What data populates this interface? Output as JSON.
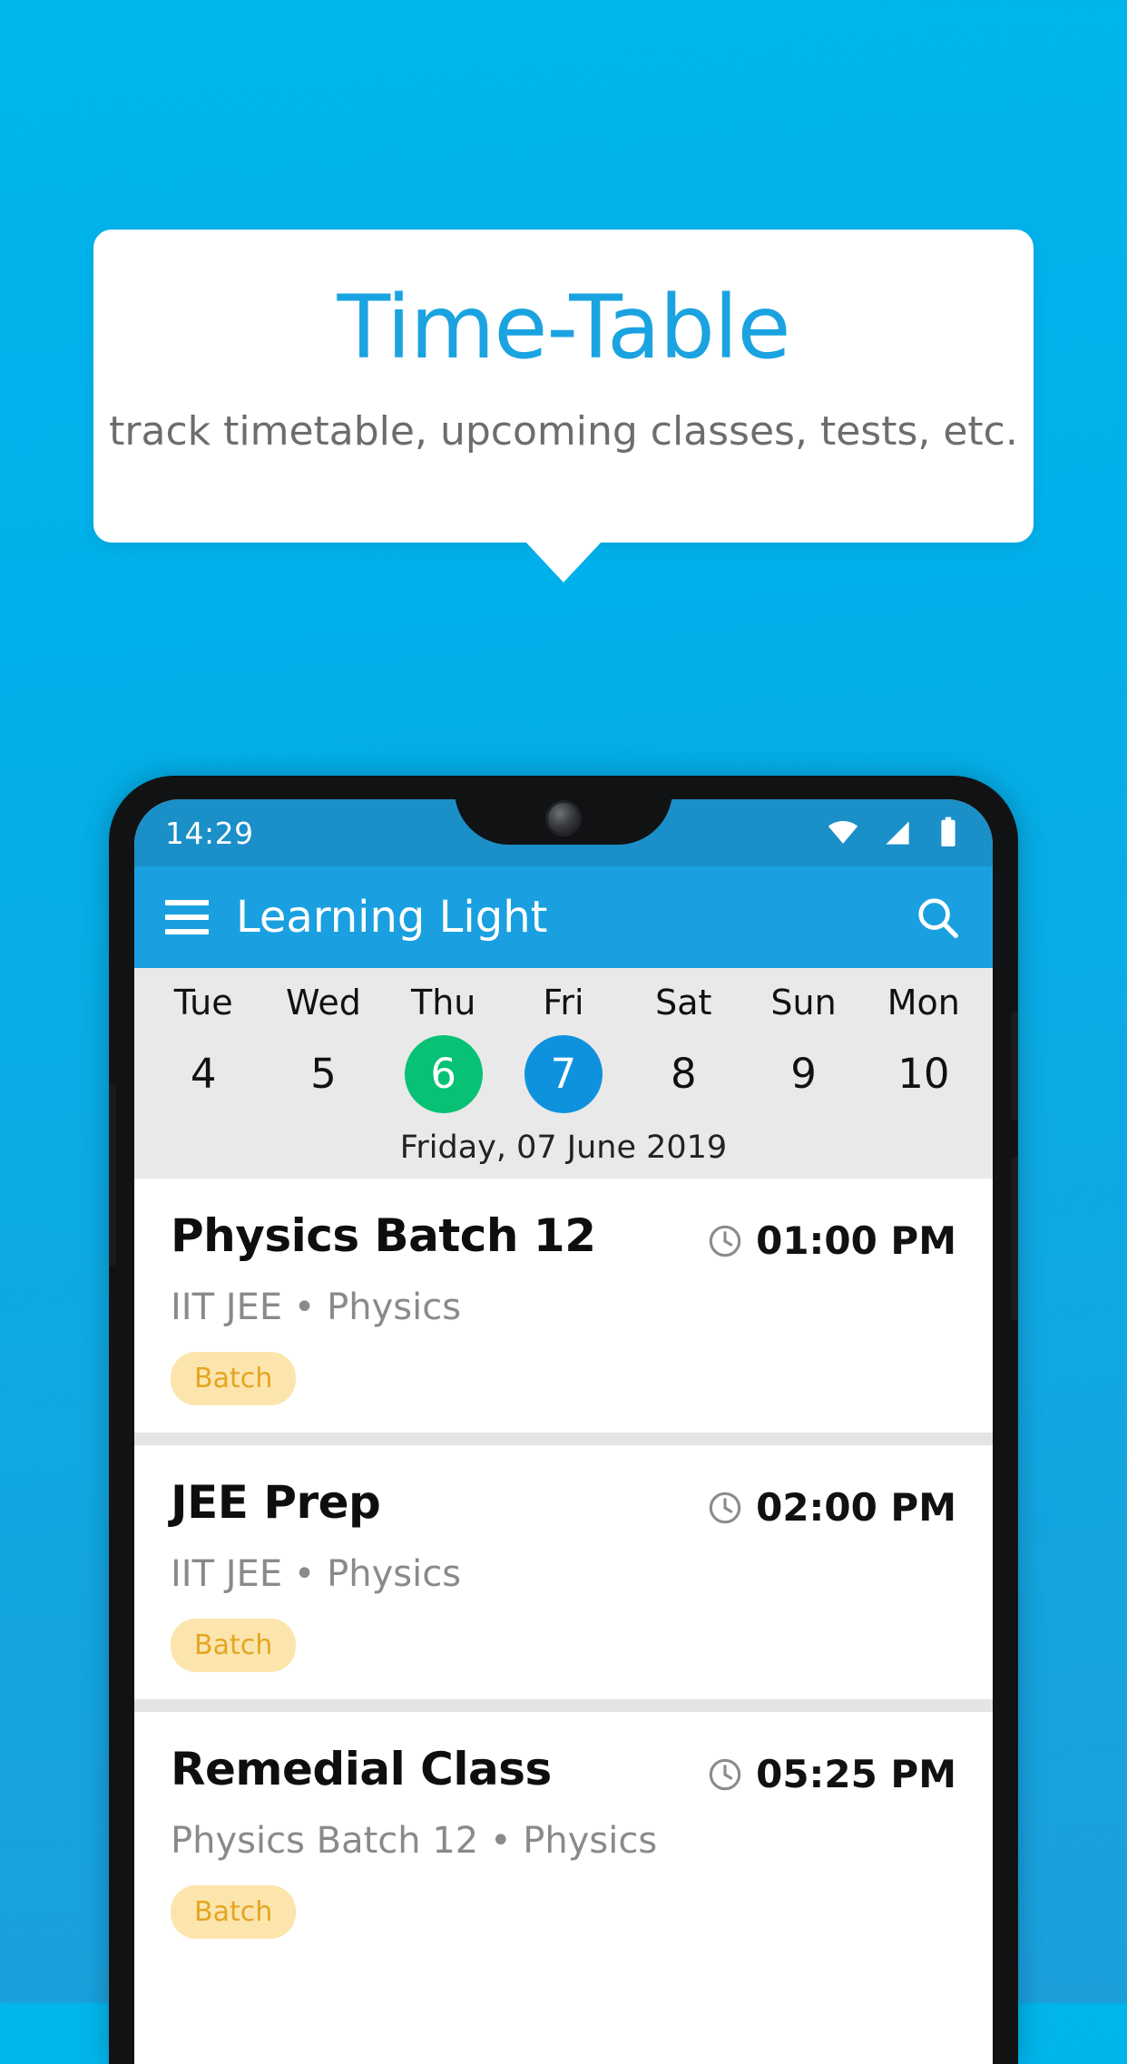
{
  "promo": {
    "title": "Time-Table",
    "subtitle": "track timetable, upcoming classes, tests, etc.",
    "title_color": "#1aa3e0",
    "background_color": "#00b0ea"
  },
  "status_bar": {
    "time": "14:29",
    "icons": [
      "wifi-icon",
      "signal-icon",
      "battery-icon"
    ]
  },
  "app_bar": {
    "menu_icon": "hamburger-menu-icon",
    "title": "Learning Light",
    "search_icon": "search-icon",
    "color": "#1aa0e0"
  },
  "date_strip": {
    "days": [
      {
        "name": "Tue",
        "num": "4",
        "state": "normal"
      },
      {
        "name": "Wed",
        "num": "5",
        "state": "normal"
      },
      {
        "name": "Thu",
        "num": "6",
        "state": "today"
      },
      {
        "name": "Fri",
        "num": "7",
        "state": "selected"
      },
      {
        "name": "Sat",
        "num": "8",
        "state": "normal"
      },
      {
        "name": "Sun",
        "num": "9",
        "state": "normal"
      },
      {
        "name": "Mon",
        "num": "10",
        "state": "normal"
      }
    ],
    "selected_date_label": "Friday, 07 June 2019",
    "today_color": "#07c274",
    "selected_color": "#0f92dd"
  },
  "schedule": {
    "items": [
      {
        "title": "Physics Batch 12",
        "subtitle": "IIT JEE • Physics",
        "time": "01:00 PM",
        "chip": "Batch"
      },
      {
        "title": "JEE Prep",
        "subtitle": "IIT JEE • Physics",
        "time": "02:00 PM",
        "chip": "Batch"
      },
      {
        "title": "Remedial Class",
        "subtitle": "Physics Batch 12 • Physics",
        "time": "05:25 PM",
        "chip": "Batch"
      }
    ],
    "chip_bg": "#fce5ad",
    "chip_text_color": "#e5a522"
  }
}
